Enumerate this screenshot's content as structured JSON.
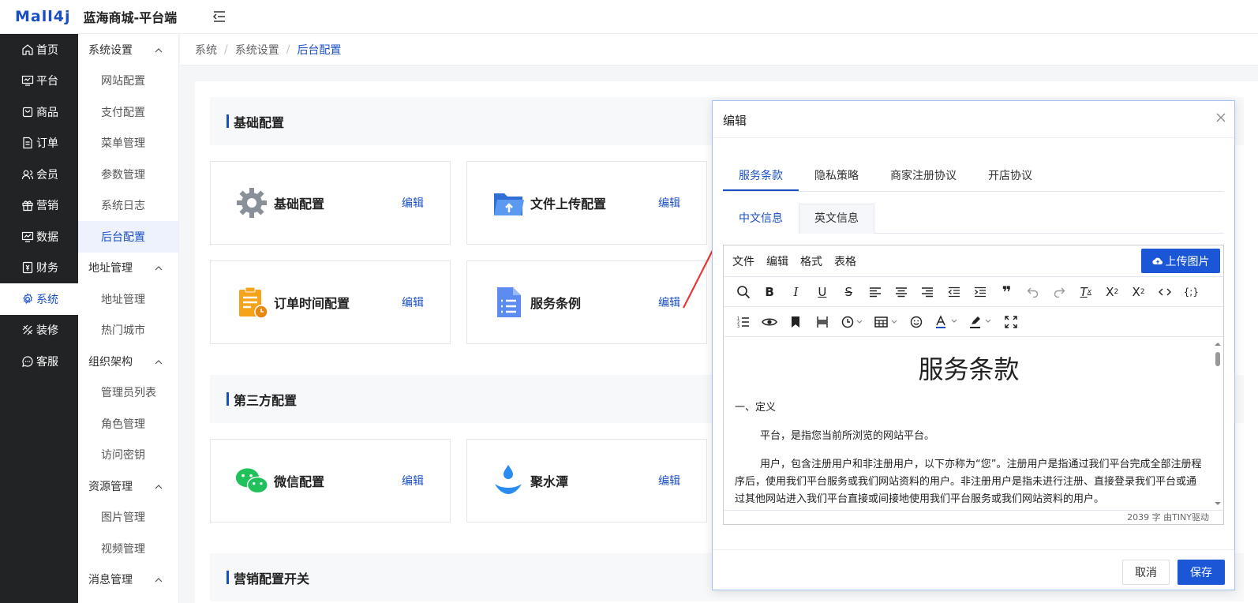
{
  "header": {
    "logo": "Mall4j",
    "name": "蓝海商城-平台端"
  },
  "nav_primary": [
    {
      "label": "首页",
      "icon": "home-icon"
    },
    {
      "label": "平台",
      "icon": "monitor-icon"
    },
    {
      "label": "商品",
      "icon": "bag-icon"
    },
    {
      "label": "订单",
      "icon": "order-icon"
    },
    {
      "label": "会员",
      "icon": "users-icon"
    },
    {
      "label": "营销",
      "icon": "gift-icon"
    },
    {
      "label": "数据",
      "icon": "chart-icon"
    },
    {
      "label": "财务",
      "icon": "finance-icon"
    },
    {
      "label": "系统",
      "icon": "gear-icon"
    },
    {
      "label": "装修",
      "icon": "brush-icon"
    },
    {
      "label": "客服",
      "icon": "chat-icon"
    }
  ],
  "nav_secondary": {
    "g1": "系统设置",
    "g1_items": [
      "网站配置",
      "支付配置",
      "菜单管理",
      "参数管理",
      "系统日志",
      "后台配置"
    ],
    "g2": "地址管理",
    "g2_items": [
      "地址管理",
      "热门城市"
    ],
    "g3": "组织架构",
    "g3_items": [
      "管理员列表",
      "角色管理",
      "访问密钥"
    ],
    "g4": "资源管理",
    "g4_items": [
      "图片管理",
      "视频管理"
    ],
    "g5": "消息管理"
  },
  "breadcrumb": [
    "系统",
    "系统设置",
    "后台配置"
  ],
  "sections": {
    "basic": "基础配置",
    "third": "第三方配置",
    "marketing": "营销配置开关"
  },
  "cards": [
    {
      "title": "基础配置",
      "edit": "编辑",
      "icon": "gear-icon"
    },
    {
      "title": "文件上传配置",
      "edit": "编辑",
      "icon": "folder-upload-icon"
    },
    {
      "title": "订单时间配置",
      "edit": "编辑",
      "icon": "clipboard-clock-icon"
    },
    {
      "title": "服务条例",
      "edit": "编辑",
      "icon": "document-list-icon"
    },
    {
      "title": "微信配置",
      "edit": "编辑",
      "icon": "wechat-icon"
    },
    {
      "title": "聚水潭",
      "edit": "编辑",
      "icon": "water-drop-icon"
    }
  ],
  "dialog": {
    "title": "编辑",
    "tabs": [
      "服务条款",
      "隐私策略",
      "商家注册协议",
      "开店协议"
    ],
    "subtabs": [
      "中文信息",
      "英文信息"
    ],
    "menus": [
      "文件",
      "编辑",
      "格式",
      "表格"
    ],
    "upload": "上传图片",
    "doc_title": "服务条款",
    "doc_p1": "一、定义",
    "doc_p2": "平台，是指您当前所浏览的网站平台。",
    "doc_p3": "用户，包含注册用户和非注册用户，以下亦称为“您”。注册用户是指通过我们平台完成全部注册程序后，使用我们平台服务或我们网站资料的用户。非注册用户是指未进行注册、直接登录我们平台或通过其他网站进入我们平台直接或间接地使用我们平台服务或我们网站资料的用户。",
    "status": "2039 字  由TINY驱动",
    "cancel": "取消",
    "save": "保存"
  },
  "colors": {
    "accent": "#1a4fc4",
    "button": "#1a56d6",
    "annotation": "#e53935"
  }
}
